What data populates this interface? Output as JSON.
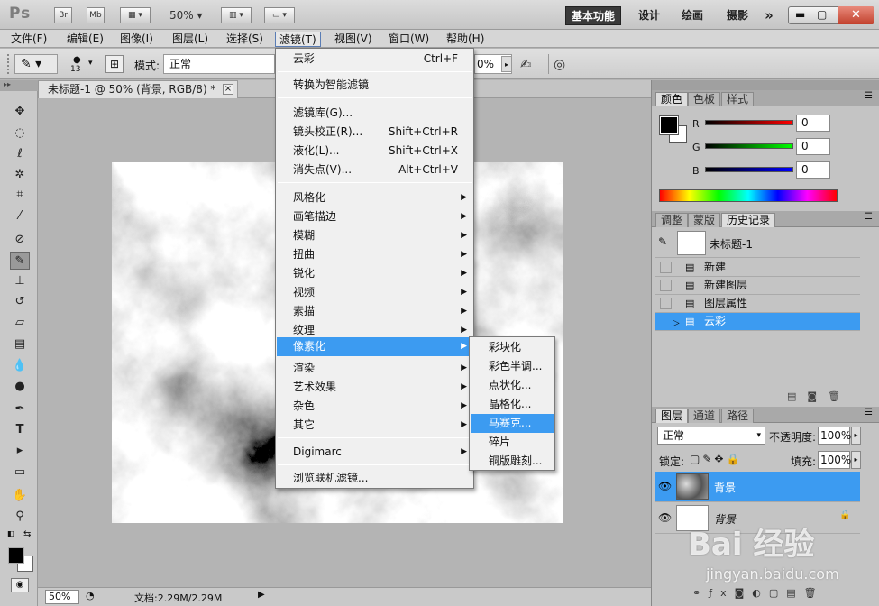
{
  "app": {
    "logo": "Ps",
    "bridge": "Br",
    "minibridge": "Mb",
    "zoom": "50%",
    "workspaces": [
      "基本功能",
      "设计",
      "绘画",
      "摄影"
    ],
    "more": "»"
  },
  "menubar": [
    "文件(F)",
    "编辑(E)",
    "图像(I)",
    "图层(L)",
    "选择(S)",
    "滤镜(T)",
    "视图(V)",
    "窗口(W)",
    "帮助(H)"
  ],
  "options": {
    "brush_size": "13",
    "mode_label": "模式:",
    "mode_value": "正常",
    "opacity_value": "0%"
  },
  "document": {
    "tab_title": "未标题-1 @ 50% (背景, RGB/8) *",
    "close": "×"
  },
  "status": {
    "zoom": "50%",
    "doc_info": "文档:2.29M/2.29M"
  },
  "filter_menu": {
    "items": [
      {
        "label": "云彩",
        "shortcut": "Ctrl+F"
      },
      {
        "label": "转换为智能滤镜",
        "shortcut": ""
      },
      {
        "label": "滤镜库(G)...",
        "shortcut": ""
      },
      {
        "label": "镜头校正(R)...",
        "shortcut": "Shift+Ctrl+R"
      },
      {
        "label": "液化(L)...",
        "shortcut": "Shift+Ctrl+X"
      },
      {
        "label": "消失点(V)...",
        "shortcut": "Alt+Ctrl+V"
      },
      {
        "label": "风格化",
        "shortcut": ""
      },
      {
        "label": "画笔描边",
        "shortcut": ""
      },
      {
        "label": "模糊",
        "shortcut": ""
      },
      {
        "label": "扭曲",
        "shortcut": ""
      },
      {
        "label": "锐化",
        "shortcut": ""
      },
      {
        "label": "视频",
        "shortcut": ""
      },
      {
        "label": "素描",
        "shortcut": ""
      },
      {
        "label": "纹理",
        "shortcut": ""
      },
      {
        "label": "像素化",
        "shortcut": ""
      },
      {
        "label": "渲染",
        "shortcut": ""
      },
      {
        "label": "艺术效果",
        "shortcut": ""
      },
      {
        "label": "杂色",
        "shortcut": ""
      },
      {
        "label": "其它",
        "shortcut": ""
      },
      {
        "label": "Digimarc",
        "shortcut": ""
      },
      {
        "label": "浏览联机滤镜...",
        "shortcut": ""
      }
    ]
  },
  "pixelate_submenu": [
    "彩块化",
    "彩色半调...",
    "点状化...",
    "晶格化...",
    "马赛克...",
    "碎片",
    "铜版雕刻..."
  ],
  "color_panel": {
    "tabs": [
      "颜色",
      "色板",
      "样式"
    ],
    "channels": [
      {
        "name": "R",
        "value": "0"
      },
      {
        "name": "G",
        "value": "0"
      },
      {
        "name": "B",
        "value": "0"
      }
    ]
  },
  "history_panel": {
    "tabs": [
      "调整",
      "蒙版",
      "历史记录"
    ],
    "snapshot": "未标题-1",
    "steps": [
      "新建",
      "新建图层",
      "图层属性",
      "云彩"
    ]
  },
  "layers_panel": {
    "tabs": [
      "图层",
      "通道",
      "路径"
    ],
    "blend": "正常",
    "opacity_label": "不透明度:",
    "opacity": "100%",
    "lock_label": "锁定:",
    "fill_label": "填充:",
    "fill": "100%",
    "layers": [
      {
        "name": "背景"
      },
      {
        "name": "背景"
      }
    ]
  },
  "watermark": {
    "brand": "Bai 经验",
    "url": "jingyan.baidu.com"
  }
}
